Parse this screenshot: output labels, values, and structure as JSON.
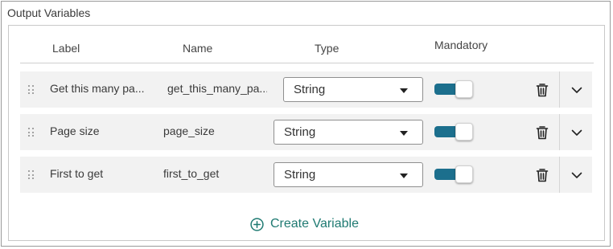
{
  "section": {
    "title": "Output Variables"
  },
  "headers": {
    "label": "Label",
    "name": "Name",
    "type": "Type",
    "mandatory": "Mandatory"
  },
  "rows": [
    {
      "label": "Get this many pa...",
      "name": "get_this_many_pa...",
      "type": "String",
      "mandatory": true
    },
    {
      "label": "Page size",
      "name": "page_size",
      "type": "String",
      "mandatory": true
    },
    {
      "label": "First to get",
      "name": "first_to_get",
      "type": "String",
      "mandatory": true
    }
  ],
  "create": {
    "label": "Create Variable"
  },
  "colors": {
    "toggle_on": "#1c6f8d",
    "link": "#1f7a72"
  },
  "icons": {
    "drag": "drag-handle-icon",
    "delete": "trash-icon",
    "expand": "chevron-down-icon",
    "create": "plus-circle-icon"
  }
}
